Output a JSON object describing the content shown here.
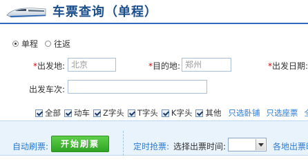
{
  "header": {
    "title": "车票查询（单程）",
    "logo_icon": "train-icon"
  },
  "trip_type": {
    "options": [
      {
        "label": "单程",
        "selected": true
      },
      {
        "label": "往返",
        "selected": false
      }
    ]
  },
  "form": {
    "from_label": "出发地:",
    "from_value": "北京",
    "to_label": "目的地:",
    "to_value": "郑州",
    "date_label": "出发日期:",
    "train_no_label": "出发车次:",
    "train_no_value": "",
    "required_mark": "*"
  },
  "filters": {
    "types": [
      {
        "label": "全部",
        "checked": true
      },
      {
        "label": "动车",
        "checked": true
      },
      {
        "label": "Z字头",
        "checked": true
      },
      {
        "label": "T字头",
        "checked": true
      },
      {
        "label": "K字头",
        "checked": true
      },
      {
        "label": "其他",
        "checked": true
      }
    ],
    "links": [
      "只选卧铺",
      "只选座票",
      "全"
    ]
  },
  "auto_refresh": {
    "label": "自动刷票:",
    "start_button": "开始刷票",
    "timed_label": "定时抢票:",
    "choose_time_label": "选择出票时间:",
    "time_value": "",
    "more_label": "各地出票时"
  },
  "colors": {
    "title_blue": "#1a4f8b",
    "link_blue": "#2e7bd6",
    "required_red": "#d40000",
    "button_green": "#2ea324",
    "bar_bg": "#e8f3fb"
  }
}
